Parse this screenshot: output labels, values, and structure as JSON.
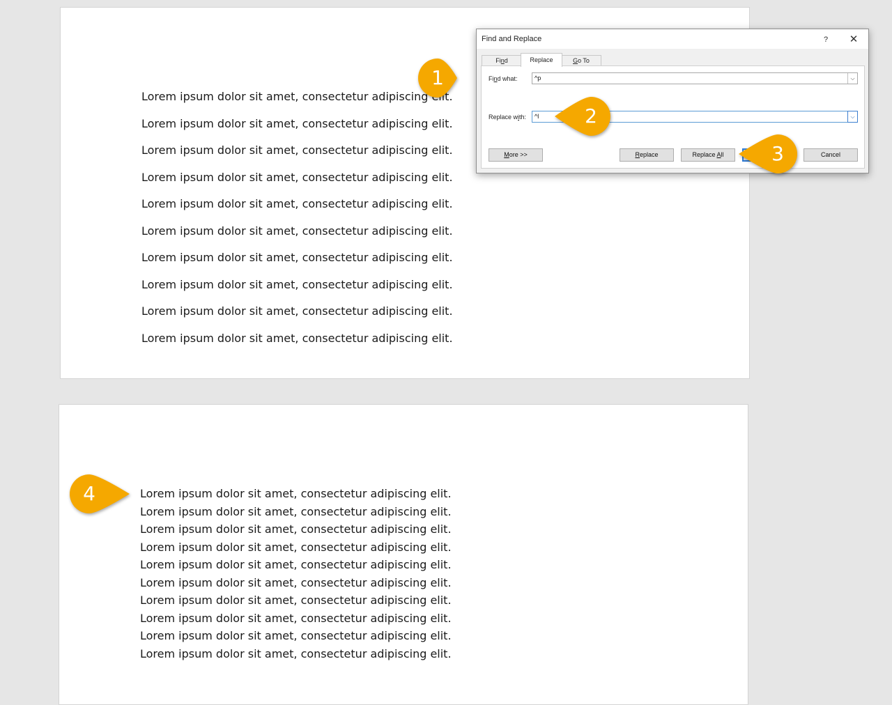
{
  "document": {
    "page1_lines": [
      "Lorem ipsum dolor sit amet, consectetur adipiscing elit.",
      "Lorem ipsum dolor sit amet, consectetur adipiscing elit.",
      "Lorem ipsum dolor sit amet, consectetur adipiscing elit.",
      "Lorem ipsum dolor sit amet, consectetur adipiscing elit.",
      "Lorem ipsum dolor sit amet, consectetur adipiscing elit.",
      "Lorem ipsum dolor sit amet, consectetur adipiscing elit.",
      "Lorem ipsum dolor sit amet, consectetur adipiscing elit.",
      "Lorem ipsum dolor sit amet, consectetur adipiscing elit.",
      "Lorem ipsum dolor sit amet, consectetur adipiscing elit.",
      "Lorem ipsum dolor sit amet, consectetur adipiscing elit."
    ],
    "page2_lines": [
      "Lorem ipsum dolor sit amet, consectetur adipiscing elit.",
      "Lorem ipsum dolor sit amet, consectetur adipiscing elit.",
      "Lorem ipsum dolor sit amet, consectetur adipiscing elit.",
      "Lorem ipsum dolor sit amet, consectetur adipiscing elit.",
      "Lorem ipsum dolor sit amet, consectetur adipiscing elit.",
      "Lorem ipsum dolor sit amet, consectetur adipiscing elit.",
      "Lorem ipsum dolor sit amet, consectetur adipiscing elit.",
      "Lorem ipsum dolor sit amet, consectetur adipiscing elit.",
      "Lorem ipsum dolor sit amet, consectetur adipiscing elit.",
      "Lorem ipsum dolor sit amet, consectetur adipiscing elit."
    ]
  },
  "dialog": {
    "title": "Find and Replace",
    "help_label": "?",
    "close_label": "✕",
    "tabs": [
      {
        "label_pre": "Fi",
        "label_key": "n",
        "label_post": "d"
      },
      {
        "label_pre": "Re",
        "label_key": "p",
        "label_post": "lace"
      },
      {
        "label_pre": "",
        "label_key": "G",
        "label_post": "o To"
      }
    ],
    "find_label_pre": "Fi",
    "find_label_key": "n",
    "find_label_post": "d what:",
    "find_value": "^p",
    "replace_label_pre": "Replace w",
    "replace_label_key": "i",
    "replace_label_post": "th:",
    "replace_value": "^l",
    "dropdown_glyph": "⌵",
    "buttons": {
      "more_key": "M",
      "more_post": "ore >>",
      "replace_key": "R",
      "replace_post": "eplace",
      "replace_all_pre": "Replace ",
      "replace_all_key": "A",
      "replace_all_post": "ll",
      "cancel": "Cancel"
    }
  },
  "callouts": [
    "1",
    "2",
    "3",
    "4"
  ],
  "colors": {
    "callout_fill": "#f5a800",
    "accent_blue": "#2e7bd6"
  }
}
